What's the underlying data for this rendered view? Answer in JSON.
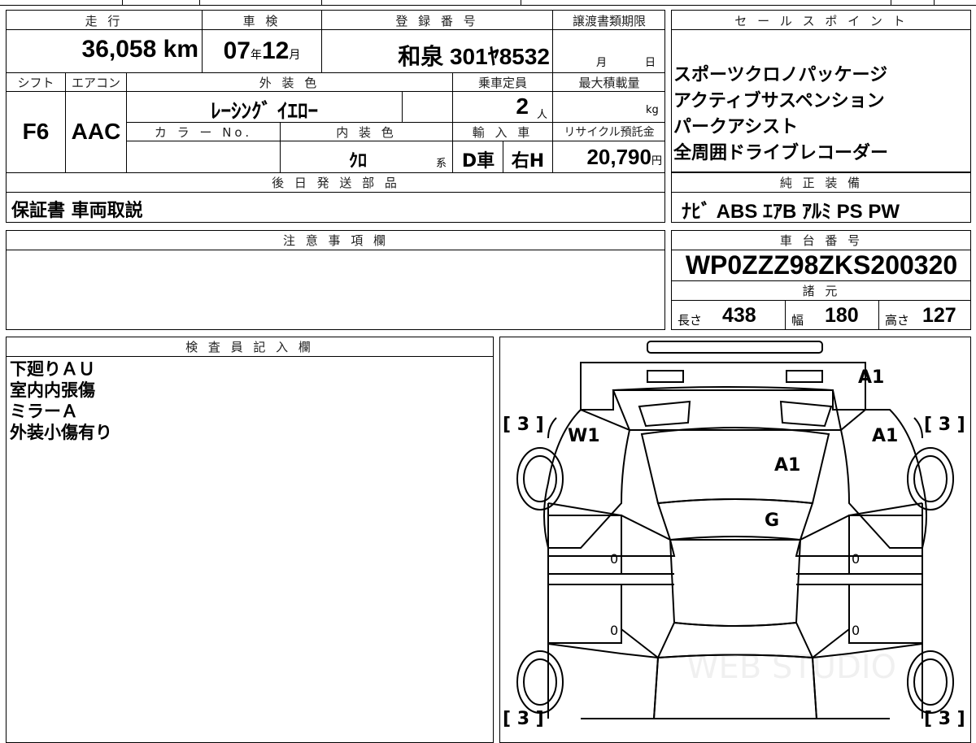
{
  "vehicle": {
    "mileage_label": "走 行",
    "mileage_value": "36,058",
    "mileage_unit": "km",
    "inspection_label": "車 検",
    "inspection_year": "07",
    "inspection_year_unit": "年",
    "inspection_month": "12",
    "inspection_month_unit": "月",
    "registration_label": "登 録 番 号",
    "registration_value": "和泉 301ﾔ8532",
    "transfer_label": "譲渡書類期限",
    "transfer_month_unit": "月",
    "transfer_day_unit": "日",
    "shift_label": "シフト",
    "shift_value": "F6",
    "aircon_label": "エアコン",
    "aircon_value": "AAC",
    "exterior_color_label": "外 装 色",
    "exterior_color_value": "ﾚｰｼﾝｸﾞ ｲｴﾛｰ",
    "capacity_label": "乗車定員",
    "capacity_value": "2",
    "capacity_unit": "人",
    "max_load_label": "最大積載量",
    "max_load_unit": "kg",
    "color_no_label": "カ ラ ー No.",
    "interior_color_label": "内 装 色",
    "interior_color_value": "ｸﾛ",
    "interior_color_suffix": "系",
    "import_label": "輸 入 車",
    "import_value": "D車",
    "steering_value": "右H",
    "recycle_label": "リサイクル預託金",
    "recycle_value": "20,790",
    "recycle_unit": "円",
    "later_parts_label": "後 日 発 送 部 品",
    "later_parts_value": "保証書 車両取説"
  },
  "sales_points": {
    "label": "セ ー ル ス ポ イ ン ト",
    "items": [
      "スポーツクロノパッケージ",
      "アクティブサスペンション",
      "パークアシスト",
      "全周囲ドライブレコーダー"
    ]
  },
  "equipment": {
    "label": "純 正 装 備",
    "value": "ﾅﾋﾞ ABS ｴｱB ｱﾙﾐ PS PW"
  },
  "notes": {
    "label": "注 意 事 項 欄",
    "value": ""
  },
  "chassis": {
    "label": "車 台 番 号",
    "value": "WP0ZZZ98ZKS200320",
    "specs_label": "諸 元",
    "length_label": "長さ",
    "length_value": "438",
    "width_label": "幅",
    "width_value": "180",
    "height_label": "高さ",
    "height_value": "127"
  },
  "inspector": {
    "label": "検 査 員 記 入 欄",
    "lines": [
      "下廻りＡＵ",
      "室内内張傷",
      "ミラーＡ",
      "外装小傷有り"
    ]
  },
  "diagram": {
    "marks": {
      "rear_bumper": "A1",
      "rear_left": "W1",
      "rear_right": "A1",
      "trunk": "A1",
      "roof": "G",
      "left_mid": "0",
      "left_low": "0",
      "right_mid": "0",
      "right_low": "0"
    },
    "tire_tl": "[ 3 ]",
    "tire_tr": "[ 3 ]",
    "tire_bl": "[ 3 ]",
    "tire_br": "[ 3 ]",
    "watermark": "WEB STUDIO"
  }
}
